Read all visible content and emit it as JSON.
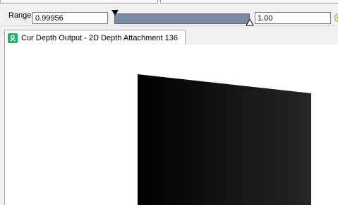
{
  "toolbar": {
    "range_label": "Range",
    "range_min": "0.99956",
    "range_max": "1.00",
    "slider_fill_fraction": 1.0
  },
  "tab": {
    "icon": "texture-viewer-icon",
    "label": "Cur Depth Output - 2D Depth Attachment 136"
  },
  "colors": {
    "slider_track": "#7c8aa4",
    "tab_icon": "#27b36b",
    "viewport_bg": "#ffffff",
    "depth_dark": "#000000",
    "depth_edge": "#262626"
  }
}
